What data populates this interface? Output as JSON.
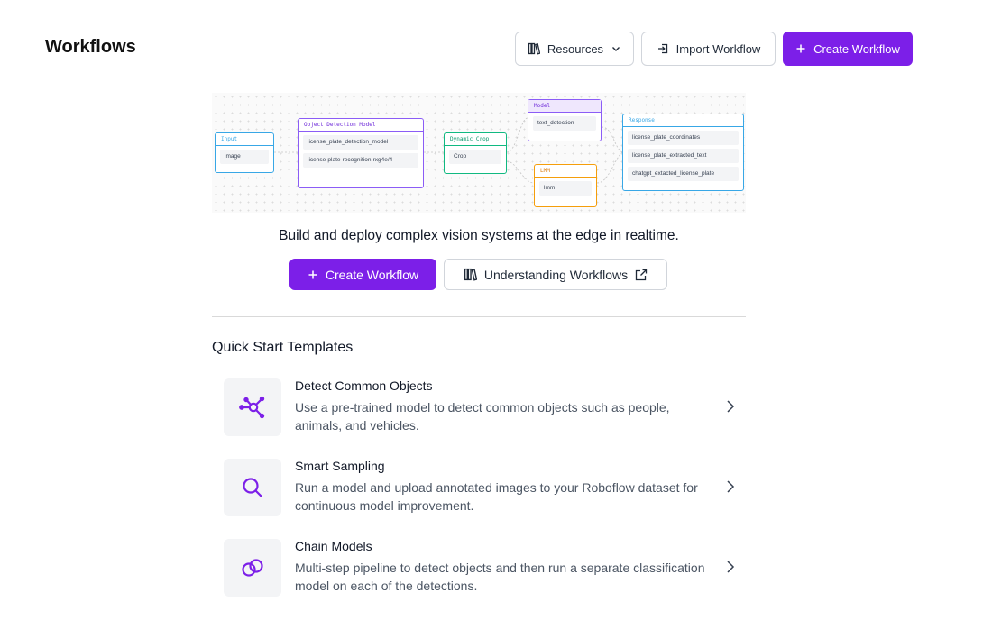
{
  "header": {
    "title": "Workflows",
    "resources_label": "Resources",
    "import_label": "Import Workflow",
    "create_label": "Create Workflow"
  },
  "diagram": {
    "input": {
      "title": "Input",
      "rows": [
        "image"
      ]
    },
    "detection": {
      "title": "Object Detection Model",
      "rows": [
        "license_plate_detection_model",
        "license-plate-recognition-rxg4e/4"
      ]
    },
    "crop": {
      "title": "Dynamic Crop",
      "rows": [
        "Crop"
      ]
    },
    "model": {
      "title": "Model",
      "rows": [
        "text_detection"
      ]
    },
    "lmm": {
      "title": "LMM",
      "rows": [
        "lmm"
      ]
    },
    "response": {
      "title": "Response",
      "rows": [
        "license_plate_coordinates",
        "license_plate_extracted_text",
        "chatgpt_extacted_license_plate"
      ]
    }
  },
  "hero": {
    "tagline": "Build and deploy complex vision systems at the edge in realtime.",
    "create_label": "Create Workflow",
    "understanding_label": "Understanding Workflows"
  },
  "quick_start": {
    "title": "Quick Start Templates",
    "templates": [
      {
        "title": "Detect Common Objects",
        "description": "Use a pre-trained model to detect common objects such as people, animals, and vehicles.",
        "icon": "detection-nodes-icon"
      },
      {
        "title": "Smart Sampling",
        "description": "Run a model and upload annotated images to your Roboflow dataset for continuous model improvement.",
        "icon": "search-icon"
      },
      {
        "title": "Chain Models",
        "description": "Multi-step pipeline to detect objects and then run a separate classification model on each of the detections.",
        "icon": "link-icon"
      }
    ]
  },
  "colors": {
    "primary": "#7c1fe8",
    "input": "#38a7e6",
    "detection": "#8b5cf6",
    "crop": "#10b981",
    "lmm": "#f59e0b"
  }
}
